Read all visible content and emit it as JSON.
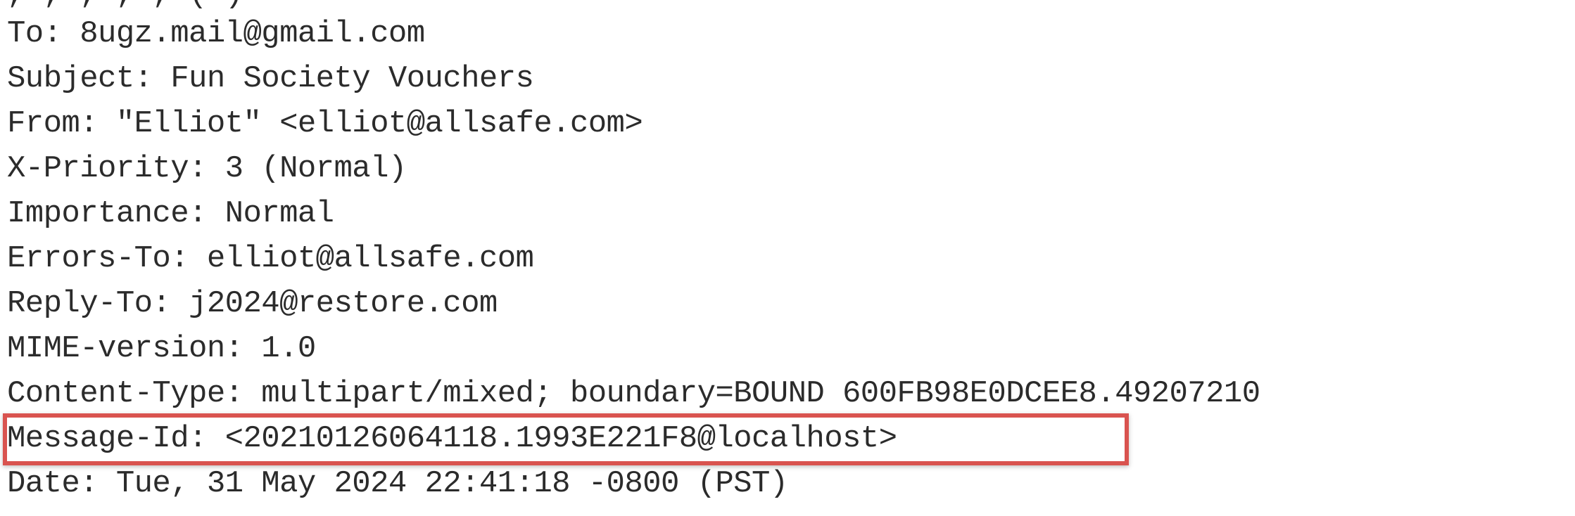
{
  "email_headers": {
    "top_partial": ", , , , , ( )",
    "lines": [
      "To: 8ugz.mail@gmail.com",
      "Subject: Fun Society Vouchers",
      "From: \"Elliot\" <elliot@allsafe.com>",
      "X-Priority: 3 (Normal)",
      "Importance: Normal",
      "Errors-To: elliot@allsafe.com",
      "Reply-To: j2024@restore.com",
      "MIME-version: 1.0",
      "Content-Type: multipart/mixed; boundary=BOUND 600FB98E0DCEE8.49207210",
      "Message-Id: <20210126064118.1993E221F8@localhost>",
      "Date: Tue, 31 May 2024 22:41:18 -0800 (PST)"
    ]
  },
  "highlight": {
    "color": "#d9534f",
    "target_line": "Message-Id: <20210126064118.1993E221F8@localhost>"
  }
}
